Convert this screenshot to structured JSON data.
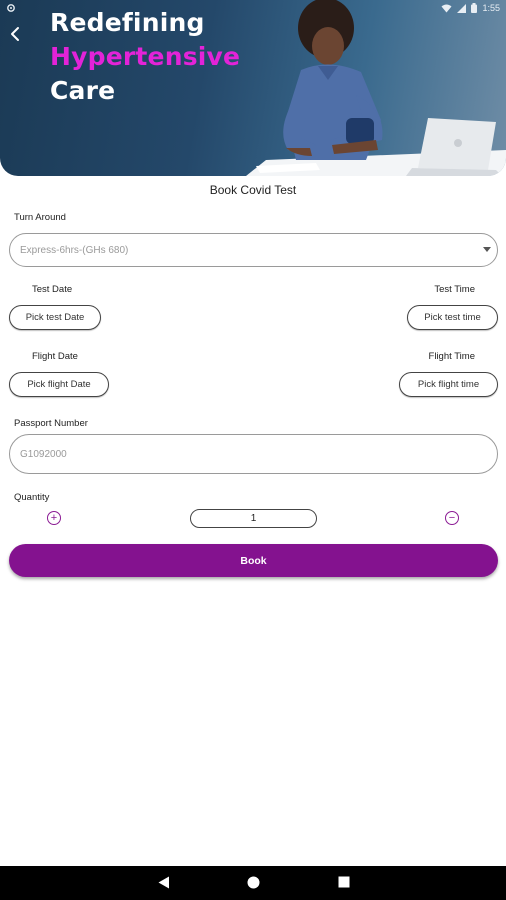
{
  "status_bar": {
    "time": "1:55",
    "icons": [
      "settings-icon",
      "wifi-icon",
      "signal-icon",
      "battery-icon"
    ]
  },
  "hero": {
    "line1": "Redefining",
    "line2": "Hypertensive",
    "line3": "Care",
    "accent_color": "#e323d8",
    "back_icon": "back-arrow-icon"
  },
  "form": {
    "title": "Book Covid Test",
    "turnaround": {
      "label": "Turn Around",
      "value": "Express-6hrs-(GHs 680)"
    },
    "test_date": {
      "label": "Test Date",
      "button": "Pick test Date"
    },
    "test_time": {
      "label": "Test Time",
      "button": "Pick test time"
    },
    "flight_date": {
      "label": "Flight Date",
      "button": "Pick flight Date"
    },
    "flight_time": {
      "label": "Flight Time",
      "button": "Pick flight time"
    },
    "passport": {
      "label": "Passport Number",
      "placeholder": "G1092000"
    },
    "quantity": {
      "label": "Quantity",
      "value": "1",
      "increment_icon": "plus-icon",
      "decrement_icon": "minus-icon"
    },
    "book_button": "Book",
    "primary_color": "#84128f"
  },
  "nav_bar": {
    "icons": [
      "back-icon",
      "home-icon",
      "recents-icon"
    ]
  }
}
